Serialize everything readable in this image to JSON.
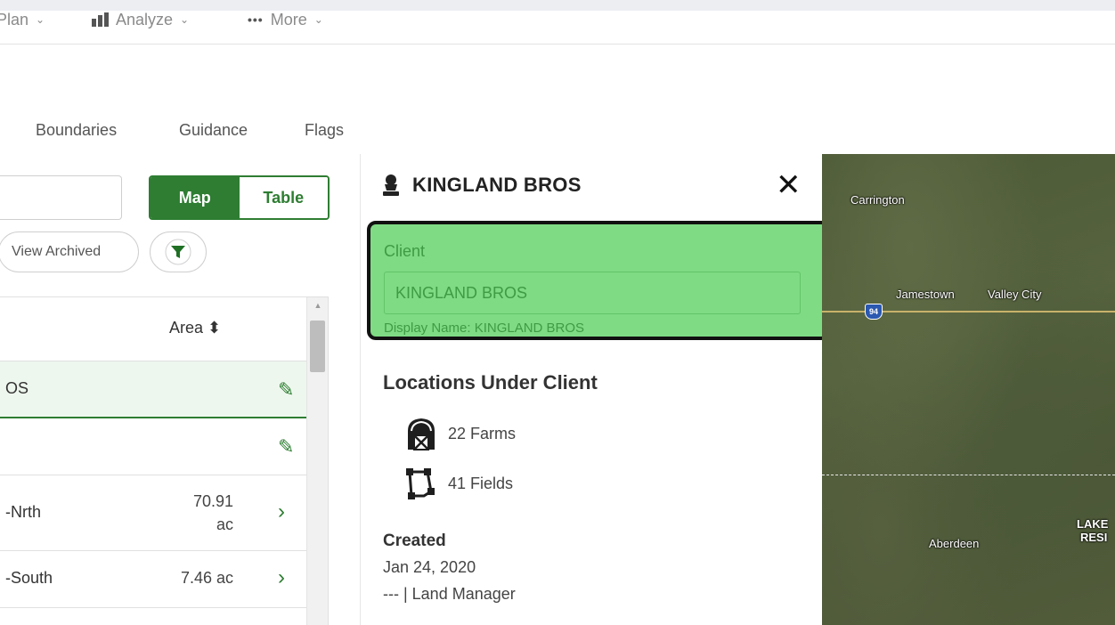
{
  "nav": {
    "plan_label": "Plan",
    "analyze_label": "Analyze",
    "more_label": "More"
  },
  "subtabs": [
    "Boundaries",
    "Guidance",
    "Flags"
  ],
  "left_panel": {
    "view_toggle": {
      "map_label": "Map",
      "table_label": "Table",
      "active": "Map"
    },
    "view_archived_label": "View Archived",
    "table": {
      "area_header": "Area ⬍",
      "rows": [
        {
          "name": "OS",
          "area": "",
          "action": "edit"
        },
        {
          "name": "",
          "area": "",
          "action": "edit"
        },
        {
          "name": "-Nrth",
          "area": "70.91 ac",
          "action": "open"
        },
        {
          "name": "-South",
          "area": "7.46 ac",
          "action": "open"
        }
      ]
    }
  },
  "detail": {
    "title": "KINGLAND BROS",
    "client_label": "Client",
    "client_value": "KINGLAND BROS",
    "display_name": "Display Name: KINGLAND BROS",
    "locations_title": "Locations Under Client",
    "farms": "22 Farms",
    "fields": "41 Fields",
    "created_label": "Created",
    "created_date": "Jan 24, 2020",
    "created_by": "--- | Land Manager"
  },
  "map": {
    "labels": [
      "Carrington",
      "Jamestown",
      "Valley City",
      "Aberdeen",
      "LAKE",
      "RESI"
    ],
    "highway_shield": "94"
  },
  "colors": {
    "accent": "#2e7d32",
    "highlight": "#7fdb84"
  }
}
